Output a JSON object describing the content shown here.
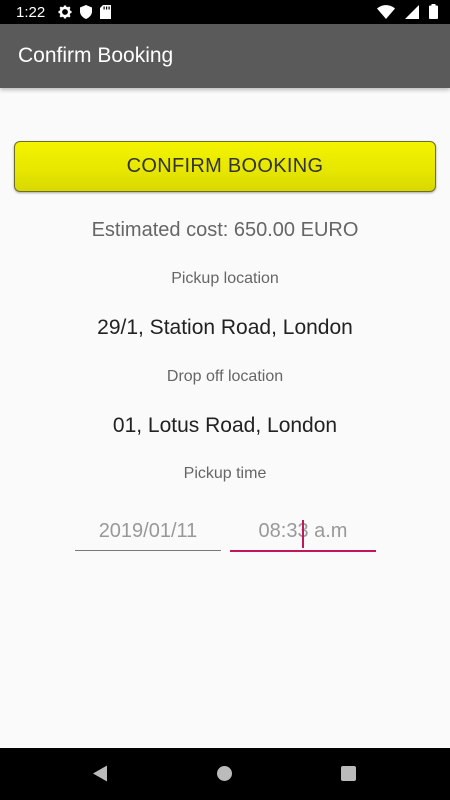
{
  "status_bar": {
    "time": "1:22",
    "icons_left": [
      "gear-icon",
      "shield-icon",
      "sd-card-icon"
    ],
    "icons_right": [
      "wifi-icon",
      "signal-icon",
      "battery-icon"
    ]
  },
  "app_bar": {
    "title": "Confirm Booking"
  },
  "booking": {
    "confirm_label": "CONFIRM BOOKING",
    "estimated_cost": "Estimated cost: 650.00 EURO",
    "pickup_label": "Pickup location",
    "pickup_value": "29/1, Station Road, London",
    "dropoff_label": "Drop off location",
    "dropoff_value": "01, Lotus Road, London",
    "time_label": "Pickup time",
    "date_value": "2019/01/11",
    "time_value": "08:33 a.m"
  },
  "colors": {
    "app_bar": "#5a5a5a",
    "button": "#eeee00",
    "accent": "#c2185b"
  }
}
